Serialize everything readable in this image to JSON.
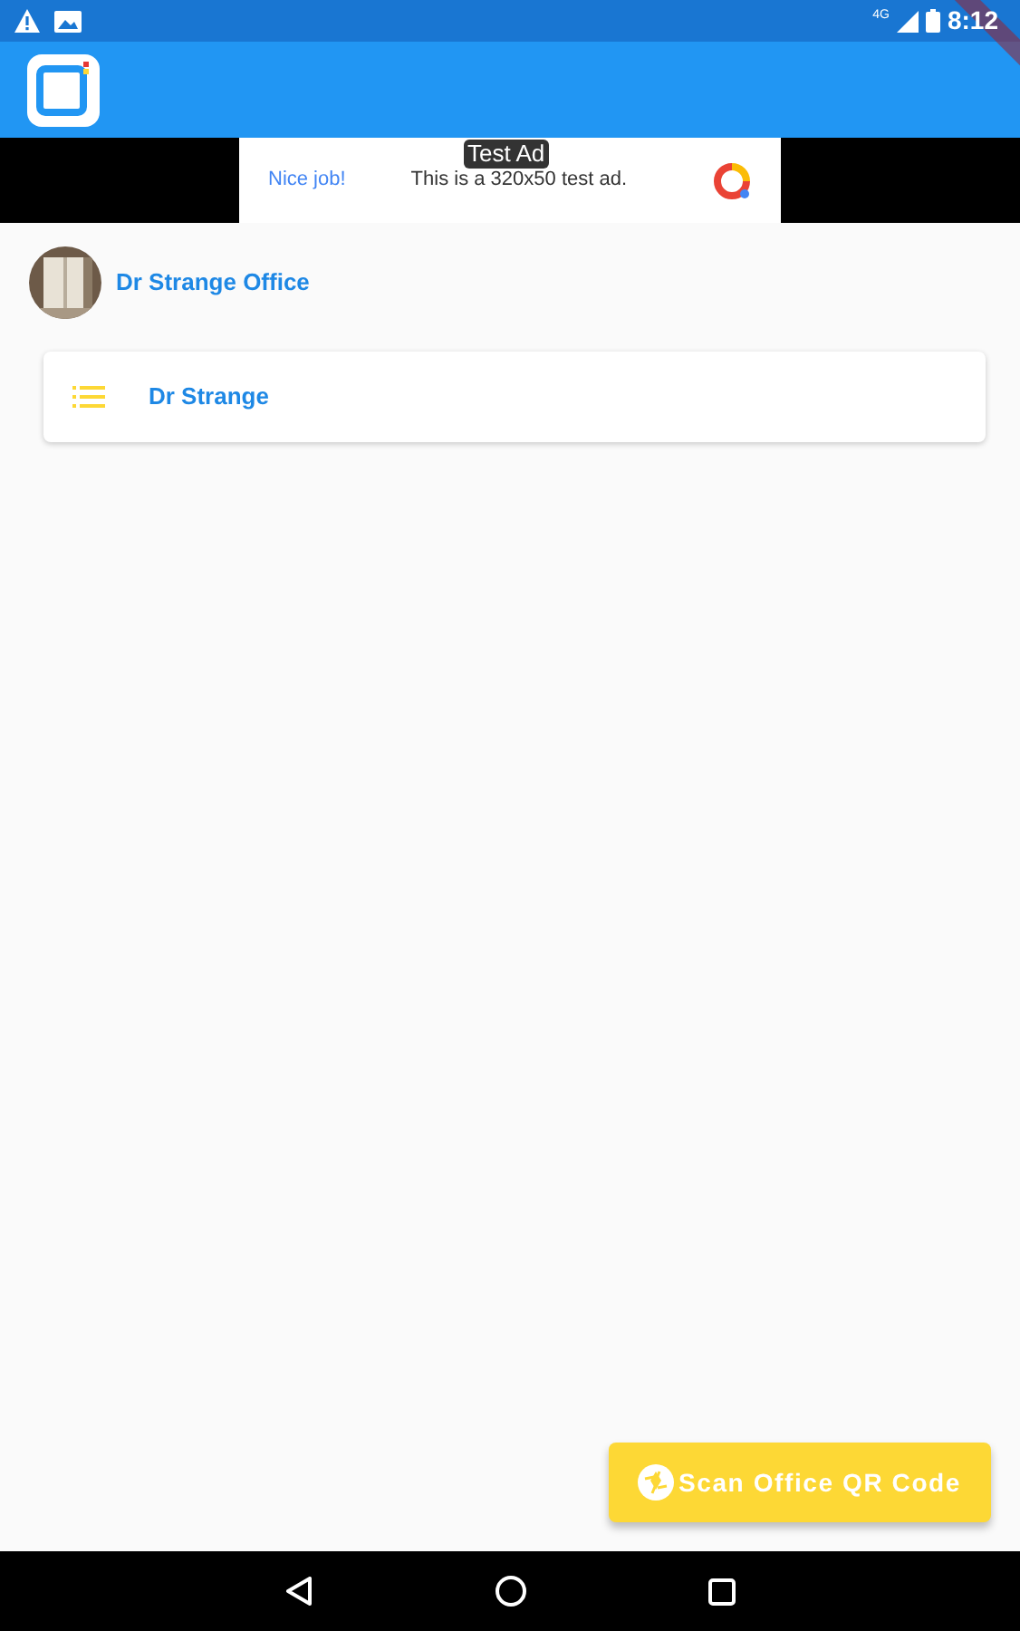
{
  "status_bar": {
    "time": "8:12",
    "network": "4G"
  },
  "ad": {
    "label": "Test Ad",
    "headline": "Nice job!",
    "body": "This is a 320x50 test ad."
  },
  "office": {
    "name": "Dr Strange Office"
  },
  "items": [
    {
      "title": "Dr Strange"
    }
  ],
  "fab": {
    "label": "Scan Office QR Code"
  }
}
